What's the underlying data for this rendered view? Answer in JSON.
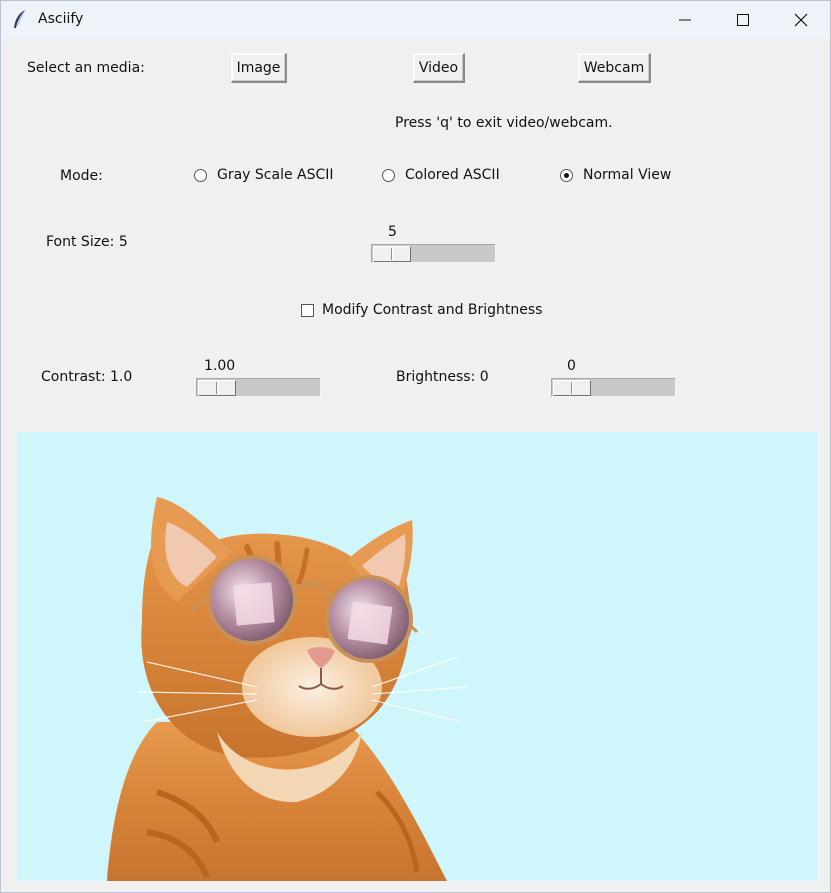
{
  "window": {
    "title": "Asciify",
    "controls": [
      "minimize-icon",
      "maximize-icon",
      "close-icon"
    ]
  },
  "media": {
    "label": "Select an media:",
    "buttons": {
      "image": "Image",
      "video": "Video",
      "webcam": "Webcam"
    },
    "hint": "Press 'q' to exit video/webcam."
  },
  "mode": {
    "label": "Mode:",
    "options": [
      "Gray Scale ASCII",
      "Colored ASCII",
      "Normal View"
    ],
    "selected": "Normal View"
  },
  "font_size": {
    "label": "Font Size: 5",
    "value": "5",
    "level": 0.0
  },
  "modify": {
    "label": "Modify Contrast and Brightness",
    "checked": false
  },
  "contrast": {
    "label": "Contrast: 1.0",
    "value": "1.00",
    "level": 0.0
  },
  "brightness": {
    "label": "Brightness: 0",
    "value": "0",
    "level": 0.0
  },
  "preview": {
    "background": "#cff6fb",
    "subject": "orange tabby cat wearing round sunglasses"
  }
}
